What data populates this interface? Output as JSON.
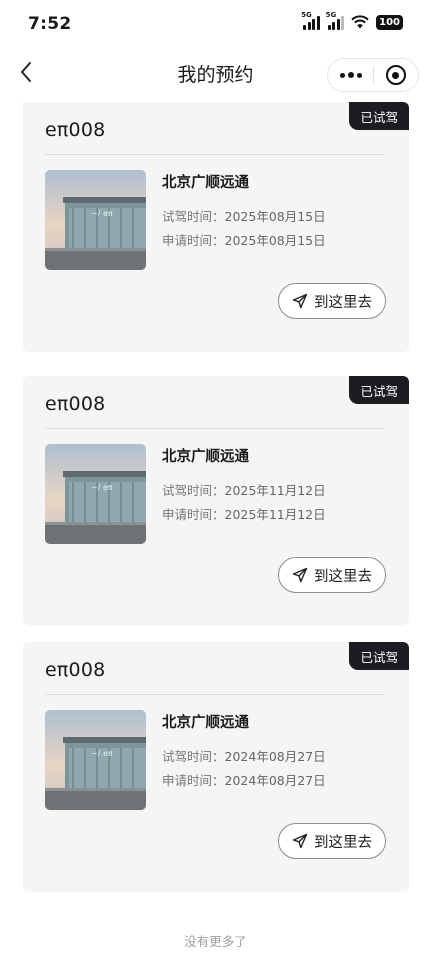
{
  "status_bar": {
    "time": "7:52",
    "signal1_label": "5G",
    "signal2_label": "5G",
    "battery": "100"
  },
  "navbar": {
    "title": "我的预约"
  },
  "appointments": [
    {
      "model": "eπ008",
      "status": "已试驾",
      "dealer": "北京广顺远通",
      "test_drive_label": "试驾时间：",
      "test_drive_time": "2025年08月15日",
      "apply_label": "申请时间：",
      "apply_time": "2025年08月15日",
      "go_label": "到这里去"
    },
    {
      "model": "eπ008",
      "status": "已试驾",
      "dealer": "北京广顺远通",
      "test_drive_label": "试驾时间：",
      "test_drive_time": "2025年11月12日",
      "apply_label": "申请时间：",
      "apply_time": "2025年11月12日",
      "go_label": "到这里去"
    },
    {
      "model": "eπ008",
      "status": "已试驾",
      "dealer": "北京广顺远通",
      "test_drive_label": "试驾时间：",
      "test_drive_time": "2024年08月27日",
      "apply_label": "申请时间：",
      "apply_time": "2024年08月27日",
      "go_label": "到这里去"
    }
  ],
  "footer": {
    "text": "没有更多了"
  },
  "colors": {
    "badge_bg": "#1c1d21",
    "card_bg": "#f5f5f5",
    "footer_text": "#a0a0a0"
  }
}
